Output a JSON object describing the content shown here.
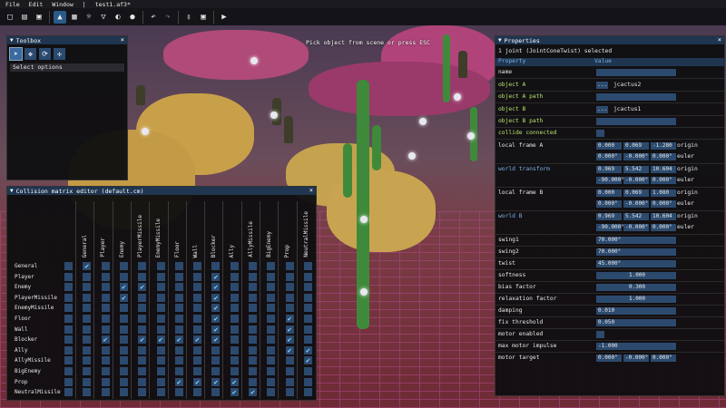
{
  "menu": [
    "File",
    "Edit",
    "Window",
    "|",
    "test1.af3*"
  ],
  "toolbar_icons": [
    "new-file-icon",
    "open-file-icon",
    "save-icon",
    "select-mode-icon",
    "image-icon",
    "sun-icon",
    "cone-icon",
    "half-circle-icon",
    "circle-icon",
    "undo-icon",
    "redo-icon",
    "trash-icon",
    "frame-icon",
    "play-icon"
  ],
  "scene_hint": "Pick object from scene or press ESC",
  "toolbox": {
    "title": "Toolbox",
    "tools": [
      "select-arrow-icon",
      "move-icon",
      "rotate-icon",
      "scale-icon"
    ],
    "select_options": "Select options"
  },
  "matrix": {
    "title": "Collision matrix editor (default.cm)",
    "columns": [
      "General",
      "Player",
      "Enemy",
      "PlayerMissile",
      "EnemyMissile",
      "Floor",
      "Wall",
      "Blocker",
      "Ally",
      "AllyMissile",
      "BigEnemy",
      "Prop",
      "NeutralMissile"
    ],
    "rows": [
      "General",
      "Player",
      "Enemy",
      "PlayerMissile",
      "EnemyMissile",
      "Floor",
      "Wall",
      "Blocker",
      "Ally",
      "AllyMissile",
      "BigEnemy",
      "Prop",
      "NeutralMissile"
    ],
    "checked": [
      [
        0,
        1
      ],
      [
        1,
        8
      ],
      [
        2,
        3
      ],
      [
        2,
        4
      ],
      [
        2,
        8
      ],
      [
        3,
        3
      ],
      [
        3,
        8
      ],
      [
        4,
        8
      ],
      [
        5,
        8
      ],
      [
        5,
        12
      ],
      [
        6,
        8
      ],
      [
        6,
        12
      ],
      [
        7,
        2
      ],
      [
        7,
        4
      ],
      [
        7,
        5
      ],
      [
        7,
        6
      ],
      [
        7,
        7
      ],
      [
        7,
        8
      ],
      [
        7,
        12
      ],
      [
        8,
        12
      ],
      [
        8,
        13
      ],
      [
        9,
        13
      ],
      [
        11,
        6
      ],
      [
        11,
        7
      ],
      [
        11,
        8
      ],
      [
        11,
        9
      ],
      [
        12,
        9
      ],
      [
        12,
        10
      ]
    ]
  },
  "properties": {
    "title": "Properties",
    "selected": "1 joint (JointConeTwist) selected",
    "col_property": "Property",
    "col_value": "Value",
    "name_label": "name",
    "objectA_label": "object A",
    "objectA_value": "jcactus2",
    "objectApath_label": "object A path",
    "objectB_label": "object B",
    "objectB_value": "jcactus1",
    "objectBpath_label": "object B path",
    "collide_label": "collide connected",
    "dots": "...",
    "localA_label": "local frame A",
    "localA_origin": [
      "0.000",
      "0.069",
      "-1.280"
    ],
    "localA_euler": [
      "0.000°",
      "-0.000°",
      "0.000°"
    ],
    "worldT_label": "world transform",
    "worldT_origin": [
      "0.969",
      "5.542",
      "10.604"
    ],
    "worldT_euler": [
      "-90.000°",
      "-0.000°",
      "0.000°"
    ],
    "localB_label": "local frame B",
    "localB_origin": [
      "0.000",
      "0.069",
      "1.080"
    ],
    "localB_euler": [
      "0.000°",
      "-0.000°",
      "0.000°"
    ],
    "worldB_label": "world B",
    "worldB_origin": [
      "0.969",
      "5.542",
      "10.604"
    ],
    "worldB_euler": [
      "-90.000°",
      "-0.000°",
      "0.000°"
    ],
    "origin_word": "origin",
    "euler_word": "euler",
    "swing1_label": "swing1",
    "swing1_value": "70.000°",
    "swing2_label": "swing2",
    "swing2_value": "70.000°",
    "twist_label": "twist",
    "twist_value": "45.000°",
    "softness_label": "softness",
    "softness_value": "1.000",
    "bias_label": "bias factor",
    "bias_value": "0.300",
    "relax_label": "relaxation factor",
    "relax_value": "1.000",
    "damping_label": "damping",
    "damping_value": "0.010",
    "fix_label": "fix threshold",
    "fix_value": "0.050",
    "motor_en_label": "motor enabled",
    "max_imp_label": "max motor impulse",
    "max_imp_value": "-1.000",
    "motor_target_label": "motor target",
    "motor_target": [
      "0.000°",
      "-0.000°",
      "0.000°"
    ]
  }
}
